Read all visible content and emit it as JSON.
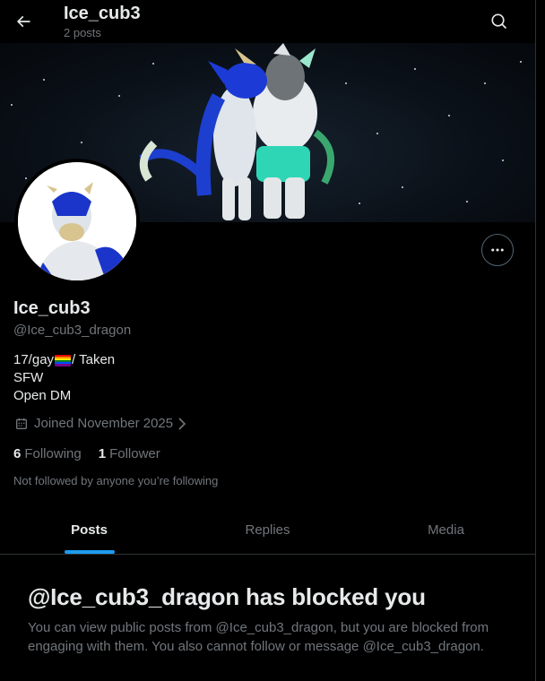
{
  "header": {
    "title": "Ice_cub3",
    "subtitle": "2 posts",
    "back_icon": "arrow-left-icon",
    "search_icon": "search-icon"
  },
  "profile": {
    "name": "Ice_cub3",
    "handle": "@Ice_cub3_dragon",
    "bio": {
      "line1_prefix": "17/gay",
      "line1_suffix": "/ Taken",
      "line2": "SFW",
      "line3": "Open DM"
    },
    "joined": "Joined November 2025",
    "following_count": "6",
    "following_label": "Following",
    "followers_count": "1",
    "followers_label": "Follower",
    "not_followed": "Not followed by anyone you’re following"
  },
  "tabs": [
    {
      "label": "Posts",
      "active": true
    },
    {
      "label": "Replies",
      "active": false
    },
    {
      "label": "Media",
      "active": false
    }
  ],
  "blocked": {
    "title": "@Ice_cub3_dragon has blocked you",
    "text": "You can view public posts from @Ice_cub3_dragon, but you are blocked from engaging with them. You also cannot follow or message @Ice_cub3_dragon."
  },
  "colors": {
    "background": "#000000",
    "text_primary": "#e7e9ea",
    "text_secondary": "#71767b",
    "accent": "#1d9bf0",
    "border": "#2f3336"
  }
}
